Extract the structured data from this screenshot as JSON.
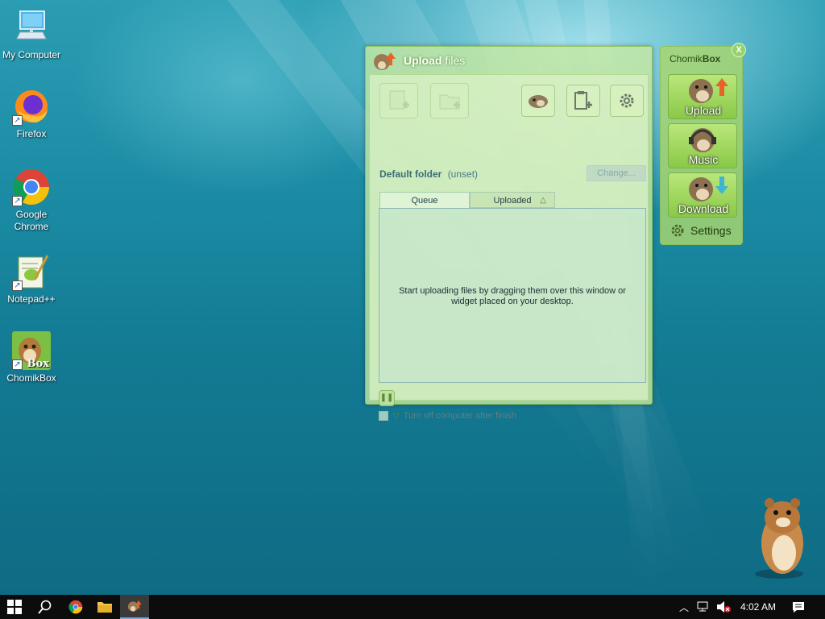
{
  "desktop": {
    "icons": [
      {
        "label": "My Computer",
        "icon": "computer-icon"
      },
      {
        "label": "Firefox",
        "icon": "firefox-icon"
      },
      {
        "label": "Google Chrome",
        "icon": "chrome-icon"
      },
      {
        "label": "Notepad++",
        "icon": "notepadpp-icon"
      },
      {
        "label": "ChomikBox",
        "icon": "chomikbox-icon",
        "badge": "Box"
      }
    ]
  },
  "upload_window": {
    "title_bold": "Upload",
    "title_rest": " files",
    "default_folder_label": "Default folder",
    "default_folder_value": "(unset)",
    "change_button": "Change...",
    "tabs": {
      "queue": "Queue",
      "uploaded": "Uploaded"
    },
    "empty_message": "Start uploading files by dragging them over this window or widget placed on your desktop.",
    "turn_off_label": "Turn off computer after finish"
  },
  "widget": {
    "title_bold": "Chomik",
    "title_rest": "Box",
    "close": "X",
    "buttons": {
      "upload": "Upload",
      "music": "Music",
      "download": "Download"
    },
    "settings": "Settings"
  },
  "taskbar": {
    "time": "4:02 AM"
  },
  "colors": {
    "accent_green": "#8ac948",
    "taskbar": "#0c0c0c",
    "desktop": "#1a8aa3"
  }
}
